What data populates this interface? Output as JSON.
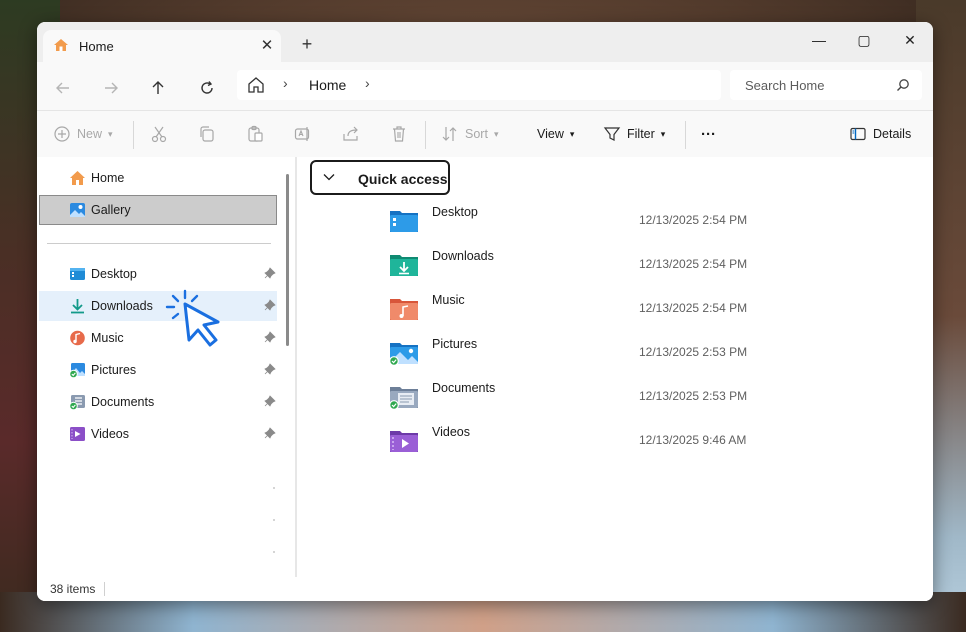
{
  "tab": {
    "title": "Home",
    "close_icon": "close-icon",
    "new_tab_symbol": "+"
  },
  "window_controls": {
    "minimize": "—",
    "maximize": "▢",
    "close": "✕"
  },
  "address": {
    "crumb": "Home",
    "separator": "›"
  },
  "search": {
    "placeholder": "Search Home"
  },
  "toolbar": {
    "new_label": "New",
    "sort_label": "Sort",
    "view_label": "View",
    "filter_label": "Filter",
    "more_label": "···",
    "details_label": "Details"
  },
  "nav": {
    "top_items": [
      {
        "label": "Home",
        "icon": "home-icon"
      },
      {
        "label": "Gallery",
        "icon": "gallery-icon",
        "selected": true
      }
    ],
    "pinned_items": [
      {
        "label": "Desktop",
        "icon": "desktop-folder-icon"
      },
      {
        "label": "Downloads",
        "icon": "downloads-folder-icon",
        "hover": true
      },
      {
        "label": "Music",
        "icon": "music-folder-icon"
      },
      {
        "label": "Pictures",
        "icon": "pictures-folder-icon",
        "synced": true
      },
      {
        "label": "Documents",
        "icon": "documents-folder-icon",
        "synced": true
      },
      {
        "label": "Videos",
        "icon": "videos-folder-icon"
      }
    ]
  },
  "quick_access": {
    "header": "Quick access",
    "items": [
      {
        "name": "Desktop",
        "date": "12/13/2025 2:54 PM",
        "icon": "desktop-folder-icon"
      },
      {
        "name": "Downloads",
        "date": "12/13/2025 2:54 PM",
        "icon": "downloads-folder-icon"
      },
      {
        "name": "Music",
        "date": "12/13/2025 2:54 PM",
        "icon": "music-folder-icon"
      },
      {
        "name": "Pictures",
        "date": "12/13/2025 2:53 PM",
        "icon": "pictures-folder-icon",
        "synced": true
      },
      {
        "name": "Documents",
        "date": "12/13/2025 2:53 PM",
        "icon": "documents-folder-icon",
        "synced": true
      },
      {
        "name": "Videos",
        "date": "12/13/2025 9:46 AM",
        "icon": "videos-folder-icon"
      }
    ]
  },
  "status": {
    "item_count": "38 items"
  },
  "colors": {
    "accent": "#0067c0",
    "selected_bg": "#cccccc",
    "hover_bg": "#e5f0fb",
    "sync_green": "#2fa84f"
  }
}
